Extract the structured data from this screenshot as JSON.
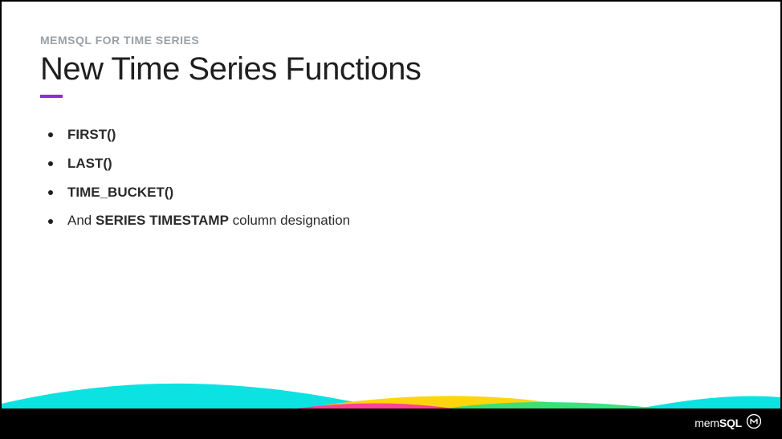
{
  "slide": {
    "eyebrow": "MEMSQL FOR TIME SERIES",
    "title": "New Time Series Functions",
    "bullets": [
      {
        "text": "FIRST()",
        "bold": true
      },
      {
        "text": "LAST()",
        "bold": true
      },
      {
        "text": "TIME_BUCKET()",
        "bold": true
      },
      {
        "text_prefix": "And ",
        "text_strong": "SERIES TIMESTAMP",
        "text_suffix": " column designation",
        "bold": false
      }
    ]
  },
  "brand": {
    "prefix": "mem",
    "suffix": "SQL"
  },
  "colors": {
    "accent": "#8f2bd6",
    "wave_cyan": "#00e0e0",
    "wave_magenta": "#ff3aa0",
    "wave_yellow": "#ffd400",
    "wave_green": "#2fe07a",
    "footer_bg": "#000000"
  }
}
